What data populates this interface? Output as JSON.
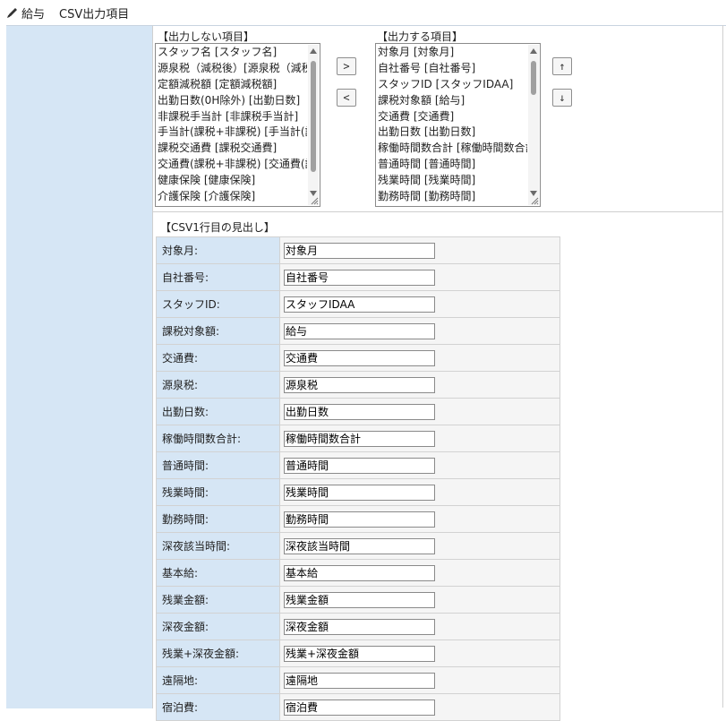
{
  "header": {
    "icon": "pencil-icon",
    "title": "給与",
    "subtitle": "CSV出力項目"
  },
  "exclude_list": {
    "caption": "【出力しない項目】",
    "items": [
      "スタッフ名 [スタッフ名]",
      "源泉税（減税後）[源泉税（減税後）]",
      "定額減税額 [定額減税額]",
      "出勤日数(0H除外) [出勤日数]",
      "非課税手当計 [非課税手当計]",
      "手当計(課税+非課税) [手当計(課税+非課税)]",
      "課税交通費 [課税交通費]",
      "交通費(課税+非課税) [交通費(課税+非課税)]",
      "健康保険 [健康保険]",
      "介護保険 [介護保険]"
    ]
  },
  "include_list": {
    "caption": "【出力する項目】",
    "items": [
      "対象月 [対象月]",
      "自社番号 [自社番号]",
      "スタッフID [スタッフIDAA]",
      "課税対象額 [給与]",
      "交通費 [交通費]",
      "出勤日数 [出勤日数]",
      "稼働時間数合計 [稼働時間数合計]",
      "普通時間 [普通時間]",
      "残業時間 [残業時間]",
      "勤務時間 [勤務時間]"
    ]
  },
  "buttons": {
    "add": ">",
    "remove": "<",
    "move_up": "↑",
    "move_down": "↓"
  },
  "csv_header": {
    "caption": "【CSV1行目の見出し】",
    "rows": [
      {
        "label": "対象月:",
        "value": "対象月"
      },
      {
        "label": "自社番号:",
        "value": "自社番号"
      },
      {
        "label": "スタッフID:",
        "value": "スタッフIDAA"
      },
      {
        "label": "課税対象額:",
        "value": "給与"
      },
      {
        "label": "交通費:",
        "value": "交通費"
      },
      {
        "label": "源泉税:",
        "value": "源泉税"
      },
      {
        "label": "出勤日数:",
        "value": "出勤日数"
      },
      {
        "label": "稼働時間数合計:",
        "value": "稼働時間数合計"
      },
      {
        "label": "普通時間:",
        "value": "普通時間"
      },
      {
        "label": "残業時間:",
        "value": "残業時間"
      },
      {
        "label": "勤務時間:",
        "value": "勤務時間"
      },
      {
        "label": "深夜該当時間:",
        "value": "深夜該当時間"
      },
      {
        "label": "基本給:",
        "value": "基本給"
      },
      {
        "label": "残業金額:",
        "value": "残業金額"
      },
      {
        "label": "深夜金額:",
        "value": "深夜金額"
      },
      {
        "label": "残業+深夜金額:",
        "value": "残業+深夜金額"
      },
      {
        "label": "遠隔地:",
        "value": "遠隔地"
      },
      {
        "label": "宿泊費:",
        "value": "宿泊費"
      }
    ]
  },
  "colors": {
    "label_bg": "#d6e6f5",
    "value_bg": "#f5f5f5"
  }
}
